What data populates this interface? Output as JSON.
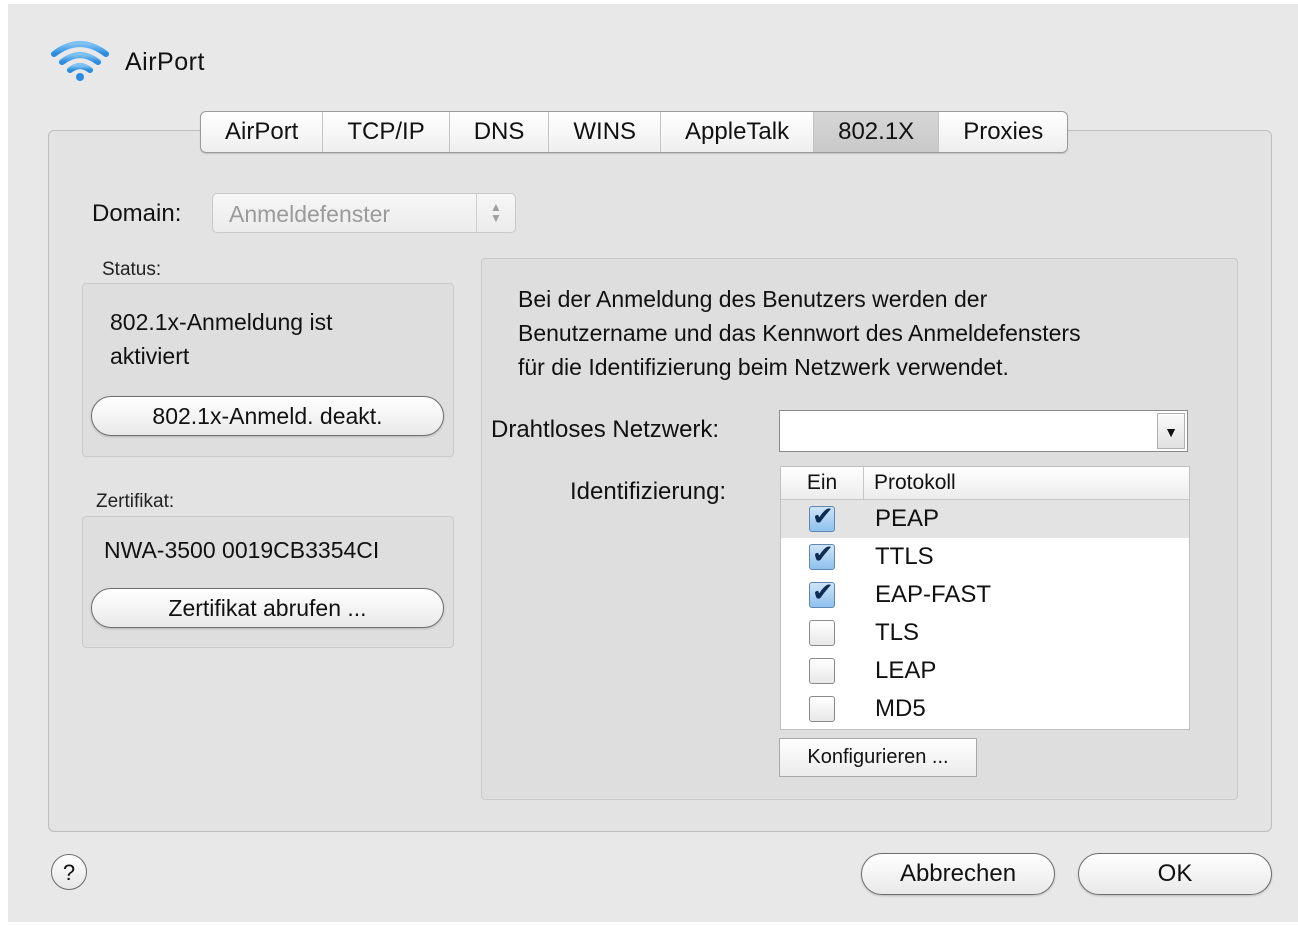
{
  "window": {
    "title": "AirPort"
  },
  "tabs": [
    {
      "label": "AirPort",
      "active": false
    },
    {
      "label": "TCP/IP",
      "active": false
    },
    {
      "label": "DNS",
      "active": false
    },
    {
      "label": "WINS",
      "active": false
    },
    {
      "label": "AppleTalk",
      "active": false
    },
    {
      "label": "802.1X",
      "active": true
    },
    {
      "label": "Proxies",
      "active": false
    }
  ],
  "domain": {
    "label": "Domain:",
    "value": "Anmeldefenster"
  },
  "status": {
    "label": "Status:",
    "text_line1": "802.1x-Anmeldung ist",
    "text_line2": "aktiviert",
    "button": "802.1x-Anmeld. deakt."
  },
  "certificate": {
    "label": "Zertifikat:",
    "value": "NWA-3500 0019CB3354CI",
    "button": "Zertifikat abrufen ..."
  },
  "description": {
    "line1": "Bei der Anmeldung des Benutzers werden der",
    "line2": "Benutzername und das Kennwort des Anmeldefensters",
    "line3": "für die Identifizierung beim Netzwerk verwendet."
  },
  "wireless": {
    "label": "Drahtloses Netzwerk:",
    "value": ""
  },
  "identification": {
    "label": "Identifizierung:",
    "columns": {
      "on": "Ein",
      "protocol": "Protokoll"
    },
    "rows": [
      {
        "name": "PEAP",
        "checked": true
      },
      {
        "name": "TTLS",
        "checked": true
      },
      {
        "name": "EAP-FAST",
        "checked": true
      },
      {
        "name": "TLS",
        "checked": false
      },
      {
        "name": "LEAP",
        "checked": false
      },
      {
        "name": "MD5",
        "checked": false
      }
    ],
    "configure_button": "Konfigurieren ..."
  },
  "footer": {
    "help": "?",
    "cancel": "Abbrechen",
    "ok": "OK"
  }
}
